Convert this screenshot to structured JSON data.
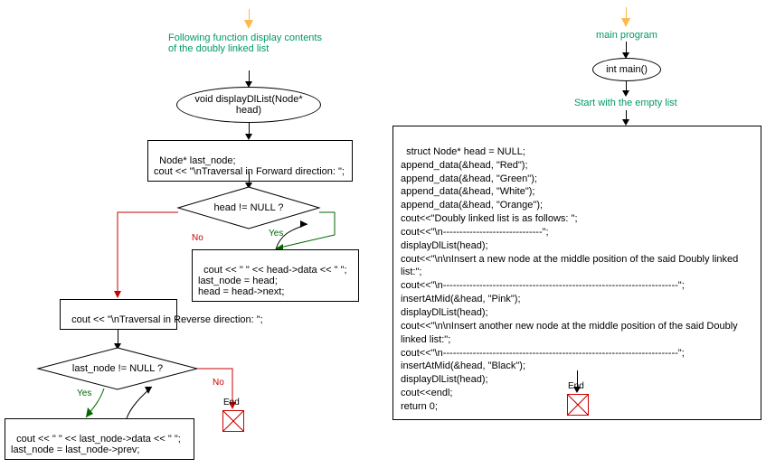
{
  "left": {
    "comment": "Following function display contents of the doubly linked list",
    "funcHeader": "void displayDlList(Node* head)",
    "block1": "Node* last_node;\ncout << \"\\nTraversal in Forward direction: \";",
    "cond1": "head != NULL ?",
    "yesBlock1": "cout << \" \" << head->data << \" \";\nlast_node = head;\nhead = head->next;",
    "noBlock1": "cout << \"\\nTraversal in Reverse direction: \";",
    "cond2": "last_node != NULL ?",
    "yesBlock2": "cout << \" \" << last_node->data << \" \";\nlast_node = last_node->prev;",
    "end": "End"
  },
  "right": {
    "commentTop": "main program",
    "mainHeader": "int main()",
    "commentStart": "Start with the empty list",
    "code": "struct Node* head = NULL;\nappend_data(&head, \"Red\");\nappend_data(&head, \"Green\");\nappend_data(&head, \"White\");\nappend_data(&head, \"Orange\");\ncout<<\"Doubly linked list is as follows: \";\ncout<<\"\\n------------------------------\";\ndisplayDlList(head);\ncout<<\"\\n\\nInsert a new node at the middle position of the said Doubly linked list:\";\ncout<<\"\\n-----------------------------------------------------------------------\";\ninsertAtMid(&head, \"Pink\");\ndisplayDlList(head);\ncout<<\"\\n\\nInsert another new node at the middle position of the said Doubly linked list:\";\ncout<<\"\\n-----------------------------------------------------------------------\";\ninsertAtMid(&head, \"Black\");\ndisplayDlList(head);\ncout<<endl;\nreturn 0;",
    "end": "End"
  },
  "labels": {
    "yes": "Yes",
    "no": "No"
  }
}
